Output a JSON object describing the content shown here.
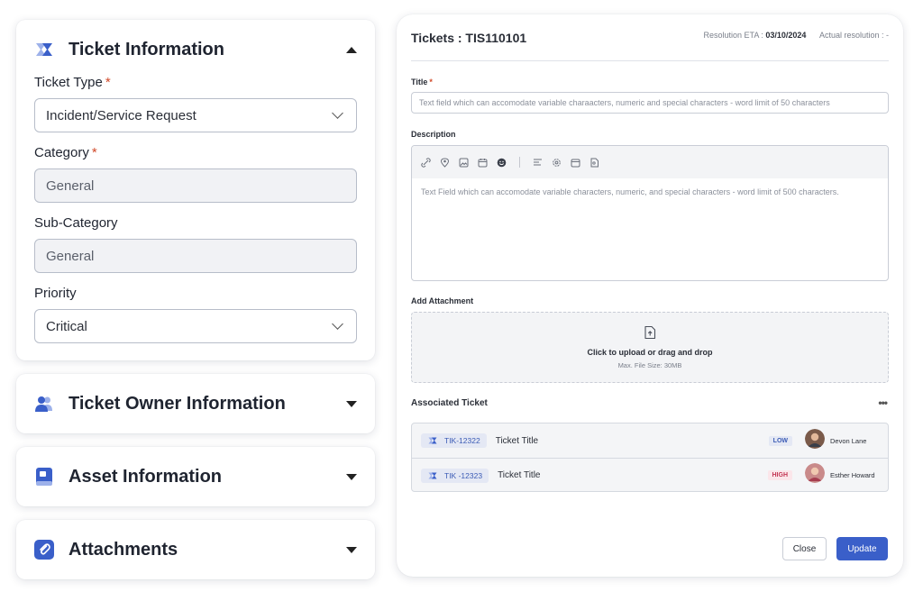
{
  "left_panel": {
    "ticket_info": {
      "title": "Ticket Information",
      "icon": "ticket-brand-icon",
      "fields": {
        "ticket_type": {
          "label": "Ticket Type",
          "required": "*",
          "value": "Incident/Service Request"
        },
        "category": {
          "label": "Category",
          "required": "*",
          "value": "General"
        },
        "sub_category": {
          "label": "Sub-Category",
          "value": "General"
        },
        "priority": {
          "label": "Priority",
          "value": "Critical"
        }
      }
    },
    "owner_info": {
      "title": "Ticket Owner Information",
      "icon": "users-icon"
    },
    "asset_info": {
      "title": "Asset Information",
      "icon": "asset-book-icon"
    },
    "attachments": {
      "title": "Attachments",
      "icon": "paperclip-icon"
    }
  },
  "right_panel": {
    "header": {
      "title": "Tickets : TIS110101",
      "eta_label": "Resolution ETA :",
      "eta_value": "03/10/2024",
      "actual_label": "Actual resolution :",
      "actual_value": "-"
    },
    "title_field": {
      "label": "Title",
      "required": "*",
      "placeholder": "Text field which can accomodate variable charaacters, numeric and special characters - word limit of 50 characters"
    },
    "description": {
      "label": "Description",
      "placeholder": "Text Field which can accomodate variable characters, numeric, and special characters - word limit of 500 characters.",
      "toolbar_icons": [
        "link-icon",
        "location-pin-icon",
        "image-icon",
        "calendar-icon",
        "emoji-icon",
        "align-left-icon",
        "settings-icon",
        "calendar-alt-icon",
        "file-image-icon"
      ]
    },
    "attachment": {
      "label": "Add Attachment",
      "main_text": "Click to upload or drag and drop",
      "sub_text": "Max. File Size: 30MB"
    },
    "associated": {
      "label": "Associated Ticket",
      "more": "•••",
      "rows": [
        {
          "id": "TIK-12322",
          "title": "Ticket Title",
          "priority": "LOW",
          "person": "Devon Lane"
        },
        {
          "id": "TIK -12323",
          "title": "Ticket Title",
          "priority": "HIGH",
          "person": "Esther Howard"
        }
      ]
    },
    "buttons": {
      "close": "Close",
      "update": "Update"
    }
  },
  "colors": {
    "accent": "#3a5fc9",
    "required": "#d14a2a",
    "priority_low": "#3b5bb5",
    "priority_high": "#c33654"
  }
}
